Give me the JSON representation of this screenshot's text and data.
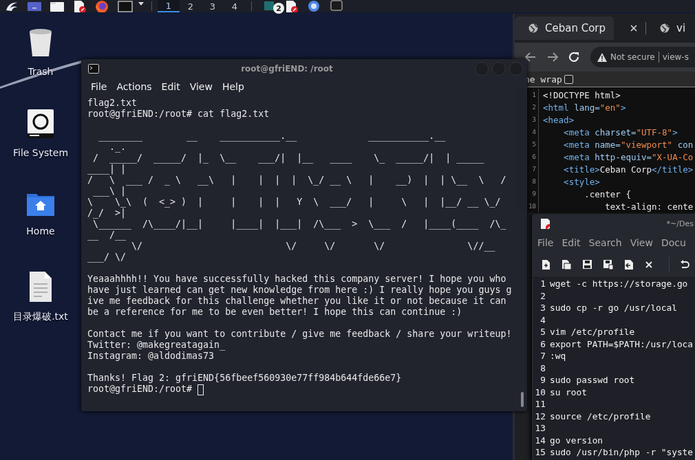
{
  "taskbar": {
    "launchers": [
      {
        "kind": "menu"
      },
      {
        "kind": "desktop"
      },
      {
        "kind": "files"
      },
      {
        "kind": "editor"
      },
      {
        "kind": "browser"
      },
      {
        "kind": "terminal"
      },
      {
        "kind": "dropdown"
      }
    ],
    "workspaces": [
      {
        "label": "1",
        "selected": true
      },
      {
        "label": "2",
        "selected": false
      },
      {
        "label": "3",
        "selected": false
      },
      {
        "label": "4",
        "selected": false
      }
    ],
    "tasks": [
      {
        "kind": "files",
        "badge": "2"
      },
      {
        "kind": "editor"
      },
      {
        "kind": "browser"
      },
      {
        "kind": "terminal"
      }
    ]
  },
  "desktop_icons": [
    {
      "kind": "trash",
      "label": "Trash"
    },
    {
      "kind": "drive",
      "label": "File System"
    },
    {
      "kind": "home",
      "label": "Home"
    },
    {
      "kind": "document",
      "label": "目录爆破.txt"
    }
  ],
  "browser": {
    "tabs": [
      {
        "label": "Ceban Corp",
        "selected": true
      },
      {
        "label": "vi",
        "selected": false
      }
    ],
    "security": "Not secure",
    "address": "view-s",
    "line_wrap": {
      "label": "ne wrap",
      "checked": false
    },
    "code": [
      {
        "number": "1",
        "tokens": [
          {
            "text": "<!DOCTYPE html>",
            "kind": "doctype"
          }
        ]
      },
      {
        "number": "2",
        "tokens": [
          {
            "text": "<html",
            "kind": "tag"
          },
          {
            "text": " lang=",
            "kind": "attr"
          },
          {
            "text": "\"en\"",
            "kind": "value"
          },
          {
            "text": ">",
            "kind": "tag"
          }
        ]
      },
      {
        "number": "3",
        "tokens": [
          {
            "text": "<head>",
            "kind": "tag"
          }
        ]
      },
      {
        "number": "4",
        "tokens": [
          {
            "text": "    <meta",
            "kind": "tag"
          },
          {
            "text": " charset=",
            "kind": "attr"
          },
          {
            "text": "\"UTF-8\"",
            "kind": "value"
          },
          {
            "text": ">",
            "kind": "tag"
          }
        ]
      },
      {
        "number": "5",
        "tokens": [
          {
            "text": "    <meta",
            "kind": "tag"
          },
          {
            "text": " name=",
            "kind": "attr"
          },
          {
            "text": "\"viewport\"",
            "kind": "value"
          },
          {
            "text": " con",
            "kind": "attr"
          }
        ]
      },
      {
        "number": "6",
        "tokens": [
          {
            "text": "    <meta",
            "kind": "tag"
          },
          {
            "text": " http-equiv=",
            "kind": "attr"
          },
          {
            "text": "\"X-UA-Co",
            "kind": "value"
          }
        ]
      },
      {
        "number": "7",
        "tokens": [
          {
            "text": "    <title>",
            "kind": "tag"
          },
          {
            "text": "Ceban Corp",
            "kind": "text"
          },
          {
            "text": "</title>",
            "kind": "tag"
          }
        ]
      },
      {
        "number": "8",
        "tokens": [
          {
            "text": "    <style>",
            "kind": "tag"
          }
        ]
      },
      {
        "number": "9",
        "tokens": [
          {
            "text": "        .center {",
            "kind": "text"
          }
        ]
      },
      {
        "number": "10",
        "tokens": [
          {
            "text": "            text-align: cente",
            "kind": "text"
          }
        ]
      }
    ]
  },
  "terminal": {
    "title": "root@gfriEND: /root",
    "menu": [
      "File",
      "Actions",
      "Edit",
      "View",
      "Help"
    ],
    "blocks": [
      [
        "flag2.txt",
        "root@gfriEND:/root# cat flag2.txt"
      ],
      [
        "  ________        __    ___________.__             ___________.__",
        "    ._.",
        " /  _____/  _____/  |_  \\__    ___/|  |__   ____    \\_  _____/|  | _____",
        "____| |",
        "/   \\  ___ /  _ \\   __\\   |    |  |  |  \\_/ __ \\   |    __)  |  | \\__  \\   /",
        " ___\\ |",
        "\\    \\_\\  (  <_> )  |     |    |  |   Y  \\  ___/   |     \\   |  |__/ __ \\_/",
        "/_/  >|",
        " \\______  /\\____/|__|     |____|  |___|  /\\___  >  \\___  /   |____(____  /\\_",
        "__  /__",
        "        \\/                          \\/     \\/       \\/               \\//__",
        "___/ \\/"
      ],
      [
        "Yeaaahhhh!! You have successfully hacked this company server! I hope you who",
        "have just learned can get new knowledge from here :) I really hope you guys g",
        "ive me feedback for this challenge whether you like it or not because it can",
        "be a reference for me to be even better! I hope this can continue :)"
      ],
      [
        "Contact me if you want to contribute / give me feedback / share your writeup!",
        "Twitter: @makegreatagain_",
        "Instagram: @aldodimas73"
      ],
      [
        "Thanks! Flag 2: gfriEND{56fbeef560930e77ff984b644fde66e7}",
        "root@gfriEND:/root# "
      ]
    ],
    "cursor": true
  },
  "editor": {
    "title": "*~/Des",
    "menu": [
      "File",
      "Edit",
      "Search",
      "View",
      "Docu"
    ],
    "toolbar": [
      {
        "kind": "new"
      },
      {
        "kind": "open"
      },
      {
        "kind": "save"
      },
      {
        "kind": "save-as"
      },
      {
        "kind": "revert"
      },
      {
        "kind": "close"
      },
      {
        "kind": "undo"
      }
    ],
    "lines": [
      {
        "number": "1",
        "text": "wget -c https://storage.go"
      },
      {
        "number": "2"
      },
      {
        "number": "3",
        "text": "sudo cp -r go /usr/local"
      },
      {
        "number": "4"
      },
      {
        "number": "5",
        "text": "vim /etc/profile"
      },
      {
        "number": "6",
        "text": "export PATH=$PATH:/usr/loca"
      },
      {
        "number": "7",
        "text": ":wq"
      },
      {
        "number": "8"
      },
      {
        "number": "9",
        "text": "sudo passwd root"
      },
      {
        "number": "10",
        "text": "su root"
      },
      {
        "number": "11"
      },
      {
        "number": "12",
        "text": "source /etc/profile"
      },
      {
        "number": "13"
      },
      {
        "number": "14",
        "text": "go version"
      },
      {
        "number": "15",
        "text": "sudo /usr/bin/php -r \"syste"
      }
    ]
  }
}
